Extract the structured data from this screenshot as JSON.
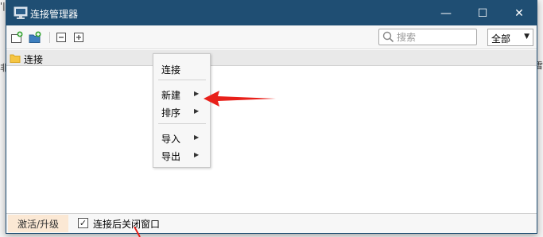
{
  "background": {
    "left_fragment_top": "'|",
    "left_fragment_mid": "非",
    "right_fragment": "雪"
  },
  "window": {
    "title": "连接管理器",
    "icon": "monitor-icon",
    "controls": {
      "minimize": "—",
      "maximize": "☐",
      "close": "✕"
    },
    "titlebar_color": "#1f4e73"
  },
  "toolbar": {
    "icons": [
      "new-connection-icon",
      "new-folder-icon",
      "collapse-all-icon",
      "expand-all-icon"
    ],
    "search": {
      "placeholder": "搜索",
      "value": ""
    },
    "filter": {
      "selected": "全部",
      "arrow": "▼"
    }
  },
  "tree": {
    "root_label": "连接",
    "root_icon": "folder-icon"
  },
  "context_menu": {
    "items": [
      {
        "label": "连接",
        "has_submenu": false
      },
      {
        "label": "新建",
        "has_submenu": true
      },
      {
        "label": "排序",
        "has_submenu": true
      },
      {
        "label": "导入",
        "has_submenu": true
      },
      {
        "label": "导出",
        "has_submenu": true
      }
    ],
    "submenu_arrow": "▶"
  },
  "statusbar": {
    "activate_label": "激活/升级",
    "checkbox_checked": true,
    "checkbox_mark": "✓",
    "checkbox_label": "连接后关闭窗口",
    "activate_bg": "#fbe8d4"
  },
  "annotation": {
    "arrow_color": "#e8201a"
  }
}
